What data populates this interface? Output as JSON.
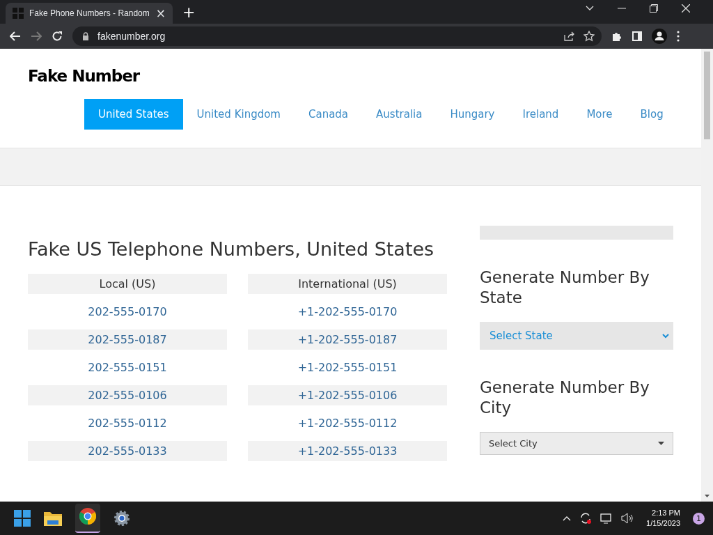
{
  "browser": {
    "tab_title": "Fake Phone Numbers - Random",
    "tab_close": "×",
    "new_tab": "+",
    "url": "fakenumber.org"
  },
  "site": {
    "logo": "Fake Number",
    "nav": [
      {
        "label": "United States",
        "selected": true
      },
      {
        "label": "United Kingdom",
        "selected": false
      },
      {
        "label": "Canada",
        "selected": false
      },
      {
        "label": "Australia",
        "selected": false
      },
      {
        "label": "Hungary",
        "selected": false
      },
      {
        "label": "Ireland",
        "selected": false
      },
      {
        "label": "More",
        "selected": false
      },
      {
        "label": "Blog",
        "selected": false
      }
    ]
  },
  "main": {
    "title": "Fake US Telephone Numbers, United States",
    "tables": [
      {
        "heading": "Local (US)",
        "numbers": [
          "202-555-0170",
          "202-555-0187",
          "202-555-0151",
          "202-555-0106",
          "202-555-0112",
          "202-555-0133"
        ]
      },
      {
        "heading": "International (US)",
        "numbers": [
          "+1-202-555-0170",
          "+1-202-555-0187",
          "+1-202-555-0151",
          "+1-202-555-0106",
          "+1-202-555-0112",
          "+1-202-555-0133"
        ]
      }
    ]
  },
  "sidebar": {
    "sections": [
      {
        "heading": "Generate Number By State",
        "select": "Select State",
        "kind": "plain"
      },
      {
        "heading": "Generate Number By City",
        "select": "Select City",
        "kind": "boxed"
      }
    ]
  },
  "taskbar": {
    "time": "2:13 PM",
    "date": "1/15/2023",
    "notification_count": "1"
  }
}
